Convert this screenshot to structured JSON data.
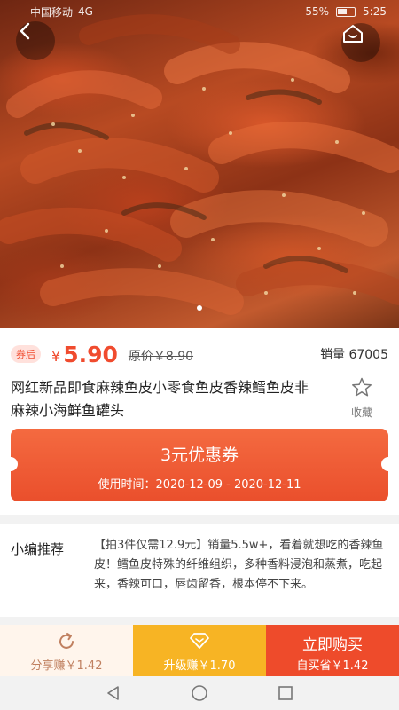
{
  "status_bar": {
    "carrier": "中国移动",
    "network": "4G",
    "battery": "55%",
    "time": "5:25"
  },
  "product": {
    "coupon_tag": "券后",
    "currency": "¥",
    "price": "5.90",
    "original_price": "原价￥8.90",
    "sales_label": "销量 67005",
    "title": "网红新品即食麻辣鱼皮小零食鱼皮香辣鳕鱼皮非麻辣小海鲜鱼罐头",
    "favorite_label": "收藏",
    "image_dots": 1,
    "accent_color": "#f04b2e"
  },
  "coupon": {
    "title": "3元优惠券",
    "date_text": "使用时间：2020-12-09 - 2020-12-11"
  },
  "recommendation": {
    "label": "小编推荐",
    "text": "【拍3件仅需12.9元】销量5.5w+，看着就想吃的香辣鱼皮！鳕鱼皮特殊的纤维组织，多种香料浸泡和蒸煮，吃起来，香辣可口，唇齿留香，根本停不下来。"
  },
  "actions": {
    "share_label": "分享赚￥1.42",
    "upgrade_label": "升级赚￥1.70",
    "buy_label": "立即购买",
    "buy_sub_label": "自买省￥1.42"
  },
  "icons": {
    "back": "back-arrow-icon",
    "home": "home-icon",
    "favorite": "star-icon",
    "share": "share-icon",
    "upgrade": "diamond-icon",
    "nav_back": "triangle-back-icon",
    "nav_home": "circle-home-icon",
    "nav_recent": "square-recent-icon"
  }
}
